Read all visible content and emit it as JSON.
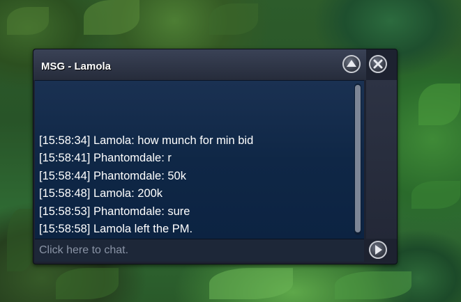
{
  "chat_window": {
    "title": "MSG - Lamola",
    "messages": [
      "[15:58:34] Lamola: how munch for min bid",
      "[15:58:41] Phantomdale: r",
      "[15:58:44] Phantomdale: 50k",
      "[15:58:48] Lamola: 200k",
      "[15:58:53] Phantomdale: sure",
      "[15:58:58] Lamola left the PM."
    ],
    "input_placeholder": "Click here to chat.",
    "buttons": {
      "scroll_up": "arrow-up-icon",
      "close": "close-icon",
      "send": "arrow-right-icon"
    }
  }
}
